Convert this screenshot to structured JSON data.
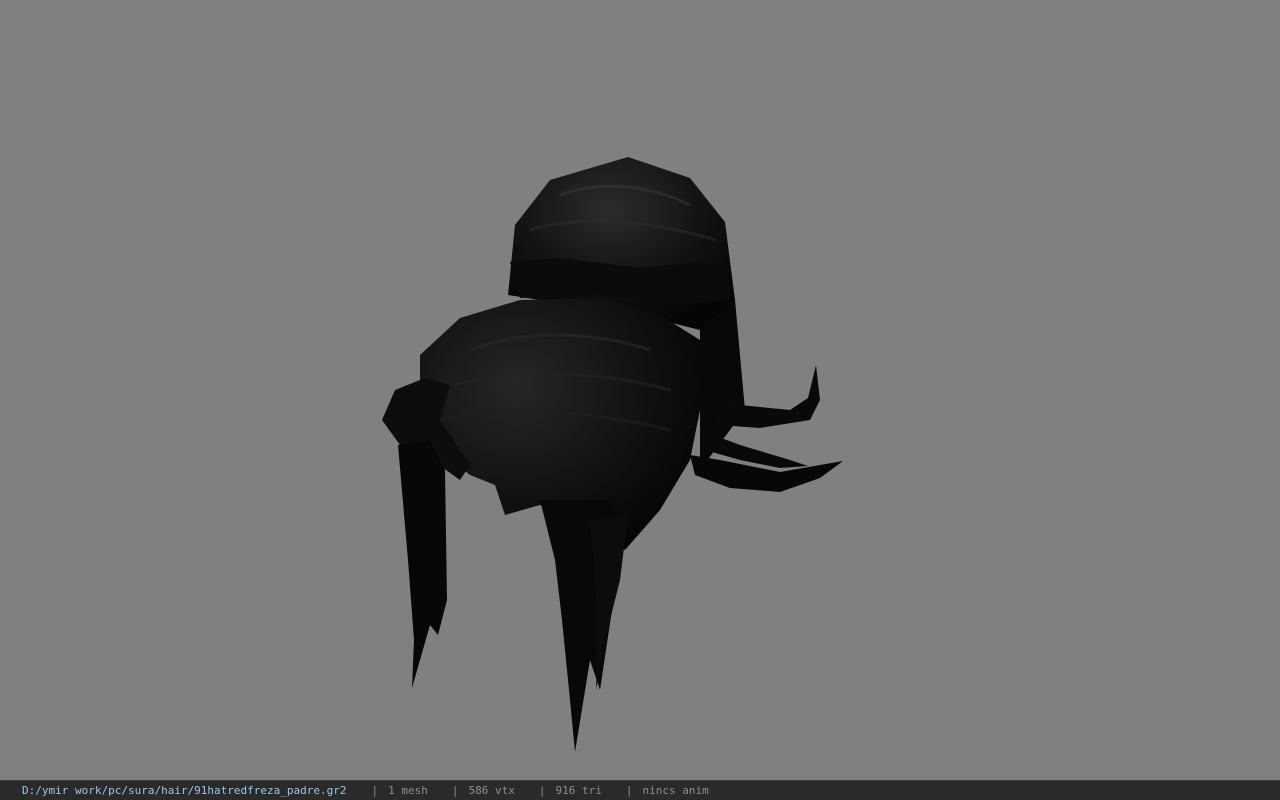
{
  "viewport": {
    "background_color": "#808080",
    "model": {
      "kind": "hair-mesh",
      "color": "#0a0a0a"
    }
  },
  "statusbar": {
    "file_path": "D:/ymir work/pc/sura/hair/91hatredfreza_padre.gr2",
    "separator": "|",
    "mesh_count": "1 mesh",
    "vertex_count": "586 vtx",
    "triangle_count": "916 tri",
    "anim_status": "nincs anim",
    "background_color": "#2a2a2a",
    "path_color": "#9ec6e0"
  }
}
